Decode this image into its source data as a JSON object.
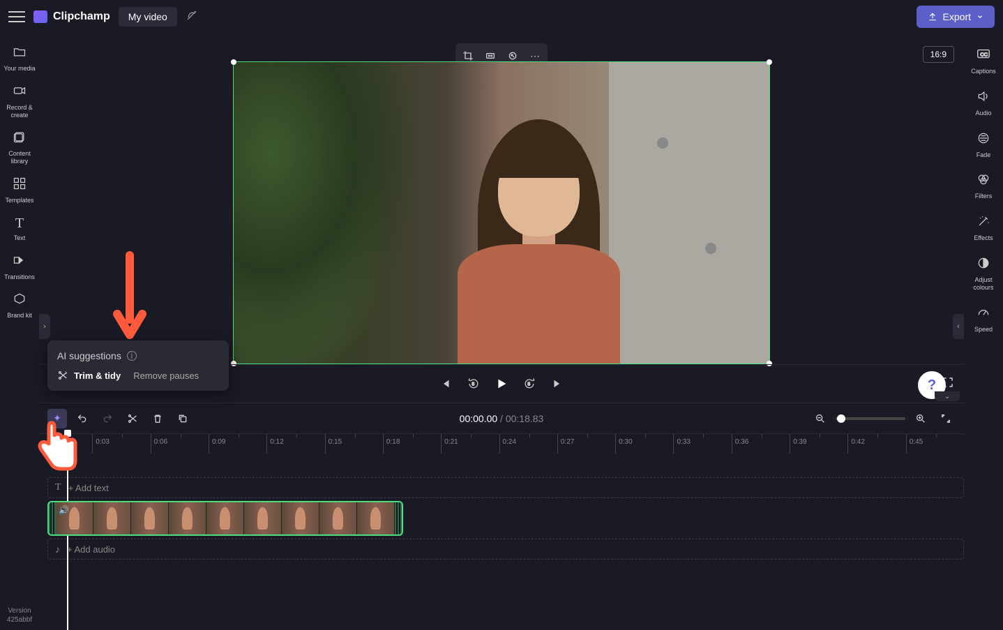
{
  "header": {
    "app_name": "Clipchamp",
    "project_name": "My video",
    "export_label": "Export"
  },
  "left_sidebar": {
    "items": [
      {
        "icon": "folder",
        "label": "Your media"
      },
      {
        "icon": "camera",
        "label": "Record & create"
      },
      {
        "icon": "library",
        "label": "Content library"
      },
      {
        "icon": "grid",
        "label": "Templates"
      },
      {
        "icon": "T",
        "label": "Text"
      },
      {
        "icon": "transitions",
        "label": "Transitions"
      },
      {
        "icon": "tag",
        "label": "Brand kit"
      }
    ],
    "version_label": "Version",
    "version": "425abbf"
  },
  "right_sidebar": {
    "items": [
      {
        "icon": "CC",
        "label": "Captions"
      },
      {
        "icon": "speaker",
        "label": "Audio"
      },
      {
        "icon": "fade",
        "label": "Fade"
      },
      {
        "icon": "filters",
        "label": "Filters"
      },
      {
        "icon": "wand",
        "label": "Effects"
      },
      {
        "icon": "contrast",
        "label": "Adjust colours"
      },
      {
        "icon": "gauge",
        "label": "Speed"
      }
    ]
  },
  "preview": {
    "aspect_ratio": "16:9"
  },
  "timeline": {
    "current_time": "00:00.00",
    "total_time": "00:18.83",
    "ruler_ticks": [
      "0:03",
      "0:06",
      "0:09",
      "0:12",
      "0:15",
      "0:18",
      "0:21",
      "0:24",
      "0:27",
      "0:30",
      "0:33",
      "0:36",
      "0:39",
      "0:42",
      "0:45"
    ],
    "add_text_label": "+ Add text",
    "add_audio_label": "+ Add audio"
  },
  "ai_popup": {
    "title": "AI suggestions",
    "trim_tidy": "Trim & tidy",
    "remove_pauses": "Remove pauses"
  }
}
